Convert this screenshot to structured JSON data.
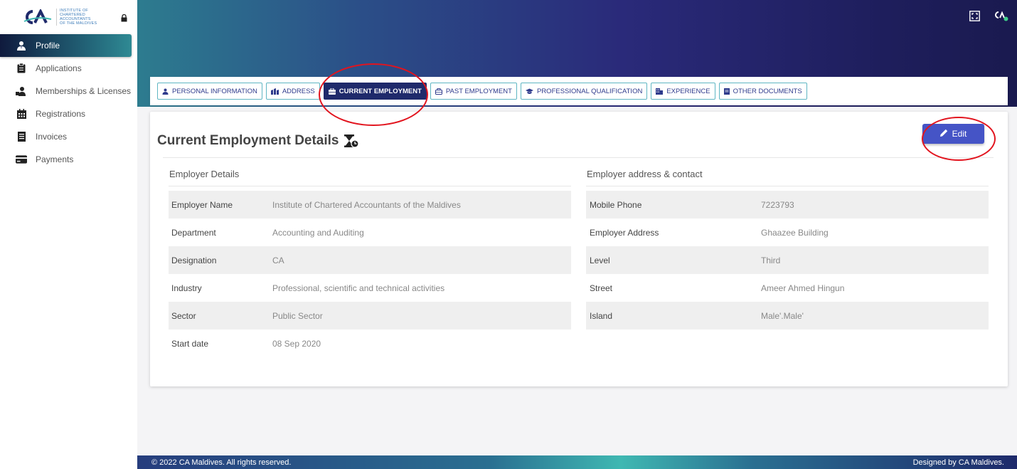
{
  "brand": {
    "logo_abbr": "CA",
    "logo_text_lines": [
      "Institute of",
      "Chartered",
      "Accountants",
      "of the Maldives"
    ]
  },
  "sidebar": {
    "items": [
      {
        "label": "Profile",
        "icon": "user-tie-icon",
        "active": true
      },
      {
        "label": "Applications",
        "icon": "clipboard-icon",
        "active": false
      },
      {
        "label": "Memberships & Licenses",
        "icon": "handshake-icon",
        "active": false
      },
      {
        "label": "Registrations",
        "icon": "calendar-icon",
        "active": false
      },
      {
        "label": "Invoices",
        "icon": "receipt-icon",
        "active": false
      },
      {
        "label": "Payments",
        "icon": "credit-card-icon",
        "active": false
      }
    ]
  },
  "tabs": [
    {
      "label": "Personal Information",
      "icon": "user-icon",
      "active": false
    },
    {
      "label": "Address",
      "icon": "map-icon",
      "active": false
    },
    {
      "label": "Current Employment",
      "icon": "briefcase-icon",
      "active": true
    },
    {
      "label": "Past Employment",
      "icon": "briefcase-outline-icon",
      "active": false
    },
    {
      "label": "Professional Qualification",
      "icon": "graduation-cap-icon",
      "active": false
    },
    {
      "label": "Experience",
      "icon": "building-icon",
      "active": false
    },
    {
      "label": "Other Documents",
      "icon": "document-icon",
      "active": false
    }
  ],
  "card": {
    "title": "Current Employment Details",
    "edit_label": "Edit"
  },
  "employer_details": {
    "title": "Employer Details",
    "rows": [
      {
        "key": "Employer Name",
        "value": "Institute of Chartered Accountants of the Maldives"
      },
      {
        "key": "Department",
        "value": "Accounting and Auditing"
      },
      {
        "key": "Designation",
        "value": "CA"
      },
      {
        "key": "Industry",
        "value": "Professional, scientific and technical activities"
      },
      {
        "key": "Sector",
        "value": "Public Sector"
      },
      {
        "key": "Start date",
        "value": "08 Sep 2020"
      }
    ]
  },
  "employer_contact": {
    "title": "Employer address & contact",
    "rows": [
      {
        "key": "Mobile Phone",
        "value": "7223793"
      },
      {
        "key": "Employer Address",
        "value": "Ghaazee Building"
      },
      {
        "key": "Level",
        "value": "Third"
      },
      {
        "key": "Street",
        "value": "Ameer Ahmed Hingun"
      },
      {
        "key": "Island",
        "value": "Male'.Male'"
      }
    ]
  },
  "footer": {
    "copyright": "© 2022 CA Maldives. All rights reserved.",
    "credit": "Designed by CA Maldives."
  },
  "colors": {
    "accent": "#4554c6",
    "tab_active": "#1f2a6b",
    "tab_border": "#5fb6c3",
    "annotation": "#e2141e"
  }
}
